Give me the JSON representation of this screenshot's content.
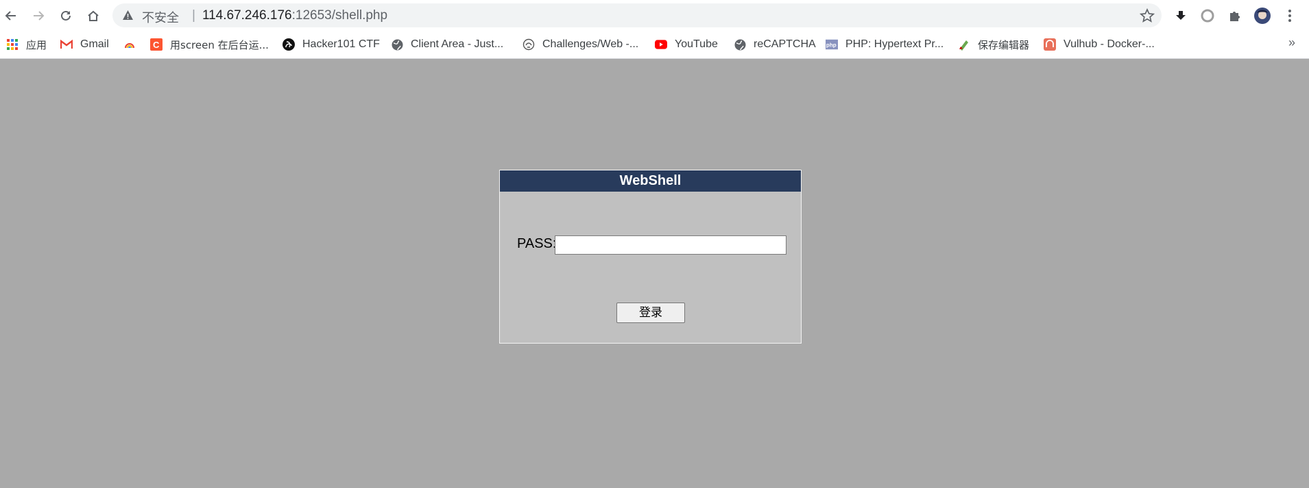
{
  "browser": {
    "security_label": "不安全",
    "separator": "|",
    "url_host": "114.67.246.176",
    "url_rest": ":12653/shell.php"
  },
  "bookmarks": [
    {
      "label": "应用",
      "icon": "apps-grid-icon"
    },
    {
      "label": "Gmail",
      "icon": "gmail-icon"
    },
    {
      "label": "",
      "icon": "rainbow-icon"
    },
    {
      "label": "用screen 在后台运...",
      "icon": "csdn-icon"
    },
    {
      "label": "Hacker101 CTF",
      "icon": "hacker101-icon"
    },
    {
      "label": "Client Area - Just...",
      "icon": "globe-icon"
    },
    {
      "label": "Challenges/Web -...",
      "icon": "rootme-icon"
    },
    {
      "label": "YouTube",
      "icon": "youtube-icon"
    },
    {
      "label": "reCAPTCHA",
      "icon": "globe-icon"
    },
    {
      "label": "PHP: Hypertext Pr...",
      "icon": "php-icon"
    },
    {
      "label": "保存编辑器",
      "icon": "editor-icon"
    },
    {
      "label": "Vulhub - Docker-...",
      "icon": "vulhub-icon"
    }
  ],
  "bookmarks_more": "»",
  "panel": {
    "title": "WebShell",
    "pass_label": "PASS:",
    "pass_value": "",
    "login_button": "登录"
  },
  "colors": {
    "page_background": "#a9a9a9",
    "panel_background": "#c0c0c0",
    "title_bar": "#283b5c"
  }
}
